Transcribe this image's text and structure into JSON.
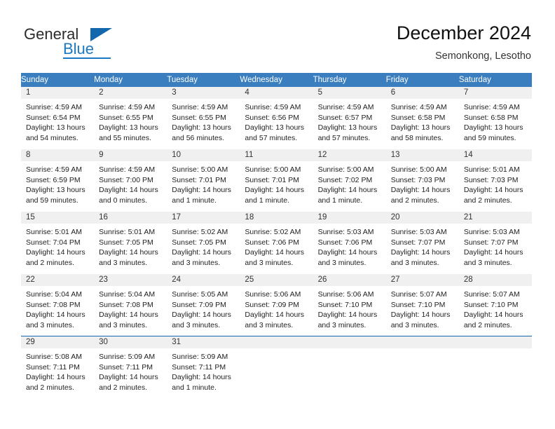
{
  "brand": {
    "name_part1": "General",
    "name_part2": "Blue",
    "flag_icon": "flag-triangle-icon"
  },
  "header": {
    "title": "December 2024",
    "subtitle": "Semonkong, Lesotho"
  },
  "colors": {
    "header_blue": "#3a7ebf",
    "brand_blue": "#1c78c0",
    "accent_line": "#1267ad",
    "day_band": "#f0f0f0"
  },
  "weekdays": [
    "Sunday",
    "Monday",
    "Tuesday",
    "Wednesday",
    "Thursday",
    "Friday",
    "Saturday"
  ],
  "weeks": [
    [
      {
        "day": "1",
        "sunrise": "Sunrise: 4:59 AM",
        "sunset": "Sunset: 6:54 PM",
        "daylight1": "Daylight: 13 hours",
        "daylight2": "and 54 minutes."
      },
      {
        "day": "2",
        "sunrise": "Sunrise: 4:59 AM",
        "sunset": "Sunset: 6:55 PM",
        "daylight1": "Daylight: 13 hours",
        "daylight2": "and 55 minutes."
      },
      {
        "day": "3",
        "sunrise": "Sunrise: 4:59 AM",
        "sunset": "Sunset: 6:55 PM",
        "daylight1": "Daylight: 13 hours",
        "daylight2": "and 56 minutes."
      },
      {
        "day": "4",
        "sunrise": "Sunrise: 4:59 AM",
        "sunset": "Sunset: 6:56 PM",
        "daylight1": "Daylight: 13 hours",
        "daylight2": "and 57 minutes."
      },
      {
        "day": "5",
        "sunrise": "Sunrise: 4:59 AM",
        "sunset": "Sunset: 6:57 PM",
        "daylight1": "Daylight: 13 hours",
        "daylight2": "and 57 minutes."
      },
      {
        "day": "6",
        "sunrise": "Sunrise: 4:59 AM",
        "sunset": "Sunset: 6:58 PM",
        "daylight1": "Daylight: 13 hours",
        "daylight2": "and 58 minutes."
      },
      {
        "day": "7",
        "sunrise": "Sunrise: 4:59 AM",
        "sunset": "Sunset: 6:58 PM",
        "daylight1": "Daylight: 13 hours",
        "daylight2": "and 59 minutes."
      }
    ],
    [
      {
        "day": "8",
        "sunrise": "Sunrise: 4:59 AM",
        "sunset": "Sunset: 6:59 PM",
        "daylight1": "Daylight: 13 hours",
        "daylight2": "and 59 minutes."
      },
      {
        "day": "9",
        "sunrise": "Sunrise: 4:59 AM",
        "sunset": "Sunset: 7:00 PM",
        "daylight1": "Daylight: 14 hours",
        "daylight2": "and 0 minutes."
      },
      {
        "day": "10",
        "sunrise": "Sunrise: 5:00 AM",
        "sunset": "Sunset: 7:01 PM",
        "daylight1": "Daylight: 14 hours",
        "daylight2": "and 1 minute."
      },
      {
        "day": "11",
        "sunrise": "Sunrise: 5:00 AM",
        "sunset": "Sunset: 7:01 PM",
        "daylight1": "Daylight: 14 hours",
        "daylight2": "and 1 minute."
      },
      {
        "day": "12",
        "sunrise": "Sunrise: 5:00 AM",
        "sunset": "Sunset: 7:02 PM",
        "daylight1": "Daylight: 14 hours",
        "daylight2": "and 1 minute."
      },
      {
        "day": "13",
        "sunrise": "Sunrise: 5:00 AM",
        "sunset": "Sunset: 7:03 PM",
        "daylight1": "Daylight: 14 hours",
        "daylight2": "and 2 minutes."
      },
      {
        "day": "14",
        "sunrise": "Sunrise: 5:01 AM",
        "sunset": "Sunset: 7:03 PM",
        "daylight1": "Daylight: 14 hours",
        "daylight2": "and 2 minutes."
      }
    ],
    [
      {
        "day": "15",
        "sunrise": "Sunrise: 5:01 AM",
        "sunset": "Sunset: 7:04 PM",
        "daylight1": "Daylight: 14 hours",
        "daylight2": "and 2 minutes."
      },
      {
        "day": "16",
        "sunrise": "Sunrise: 5:01 AM",
        "sunset": "Sunset: 7:05 PM",
        "daylight1": "Daylight: 14 hours",
        "daylight2": "and 3 minutes."
      },
      {
        "day": "17",
        "sunrise": "Sunrise: 5:02 AM",
        "sunset": "Sunset: 7:05 PM",
        "daylight1": "Daylight: 14 hours",
        "daylight2": "and 3 minutes."
      },
      {
        "day": "18",
        "sunrise": "Sunrise: 5:02 AM",
        "sunset": "Sunset: 7:06 PM",
        "daylight1": "Daylight: 14 hours",
        "daylight2": "and 3 minutes."
      },
      {
        "day": "19",
        "sunrise": "Sunrise: 5:03 AM",
        "sunset": "Sunset: 7:06 PM",
        "daylight1": "Daylight: 14 hours",
        "daylight2": "and 3 minutes."
      },
      {
        "day": "20",
        "sunrise": "Sunrise: 5:03 AM",
        "sunset": "Sunset: 7:07 PM",
        "daylight1": "Daylight: 14 hours",
        "daylight2": "and 3 minutes."
      },
      {
        "day": "21",
        "sunrise": "Sunrise: 5:03 AM",
        "sunset": "Sunset: 7:07 PM",
        "daylight1": "Daylight: 14 hours",
        "daylight2": "and 3 minutes."
      }
    ],
    [
      {
        "day": "22",
        "sunrise": "Sunrise: 5:04 AM",
        "sunset": "Sunset: 7:08 PM",
        "daylight1": "Daylight: 14 hours",
        "daylight2": "and 3 minutes."
      },
      {
        "day": "23",
        "sunrise": "Sunrise: 5:04 AM",
        "sunset": "Sunset: 7:08 PM",
        "daylight1": "Daylight: 14 hours",
        "daylight2": "and 3 minutes."
      },
      {
        "day": "24",
        "sunrise": "Sunrise: 5:05 AM",
        "sunset": "Sunset: 7:09 PM",
        "daylight1": "Daylight: 14 hours",
        "daylight2": "and 3 minutes."
      },
      {
        "day": "25",
        "sunrise": "Sunrise: 5:06 AM",
        "sunset": "Sunset: 7:09 PM",
        "daylight1": "Daylight: 14 hours",
        "daylight2": "and 3 minutes."
      },
      {
        "day": "26",
        "sunrise": "Sunrise: 5:06 AM",
        "sunset": "Sunset: 7:10 PM",
        "daylight1": "Daylight: 14 hours",
        "daylight2": "and 3 minutes."
      },
      {
        "day": "27",
        "sunrise": "Sunrise: 5:07 AM",
        "sunset": "Sunset: 7:10 PM",
        "daylight1": "Daylight: 14 hours",
        "daylight2": "and 3 minutes."
      },
      {
        "day": "28",
        "sunrise": "Sunrise: 5:07 AM",
        "sunset": "Sunset: 7:10 PM",
        "daylight1": "Daylight: 14 hours",
        "daylight2": "and 2 minutes."
      }
    ],
    [
      {
        "day": "29",
        "sunrise": "Sunrise: 5:08 AM",
        "sunset": "Sunset: 7:11 PM",
        "daylight1": "Daylight: 14 hours",
        "daylight2": "and 2 minutes."
      },
      {
        "day": "30",
        "sunrise": "Sunrise: 5:09 AM",
        "sunset": "Sunset: 7:11 PM",
        "daylight1": "Daylight: 14 hours",
        "daylight2": "and 2 minutes."
      },
      {
        "day": "31",
        "sunrise": "Sunrise: 5:09 AM",
        "sunset": "Sunset: 7:11 PM",
        "daylight1": "Daylight: 14 hours",
        "daylight2": "and 1 minute."
      },
      {
        "day": "",
        "sunrise": "",
        "sunset": "",
        "daylight1": "",
        "daylight2": ""
      },
      {
        "day": "",
        "sunrise": "",
        "sunset": "",
        "daylight1": "",
        "daylight2": ""
      },
      {
        "day": "",
        "sunrise": "",
        "sunset": "",
        "daylight1": "",
        "daylight2": ""
      },
      {
        "day": "",
        "sunrise": "",
        "sunset": "",
        "daylight1": "",
        "daylight2": ""
      }
    ]
  ]
}
